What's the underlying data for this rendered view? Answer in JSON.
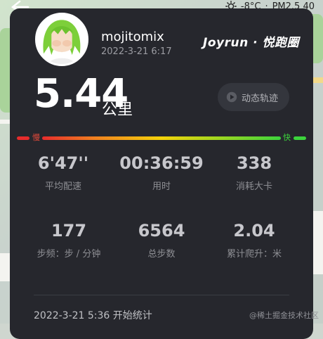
{
  "status": {
    "temperature": "-8°C",
    "separator": "·",
    "air_quality": "PM2.5 40"
  },
  "profile": {
    "username": "mojitomix",
    "datetime": "2022-3-21 6:17"
  },
  "brand": "Joyrun · 悦跑圈",
  "run": {
    "distance": "5.44",
    "unit": "公里",
    "track_button_label": "动态轨迹"
  },
  "pace_bar": {
    "slow_label": "慢",
    "fast_label": "快"
  },
  "stats": [
    {
      "value": "6'47''",
      "label": "平均配速"
    },
    {
      "value": "00:36:59",
      "label": "用时"
    },
    {
      "value": "338",
      "label": "消耗大卡"
    },
    {
      "value": "177",
      "label": "步频：步 / 分钟"
    },
    {
      "value": "6564",
      "label": "总步数"
    },
    {
      "value": "2.04",
      "label": "累计爬升：米"
    }
  ],
  "footer": {
    "start_info": "2022-3-21 5:36 开始统计"
  },
  "watermark": "@稀土掘金技术社区",
  "colors": {
    "card_bg": "#26272d",
    "slow": "#e62c2c",
    "fast": "#3cd33c"
  }
}
